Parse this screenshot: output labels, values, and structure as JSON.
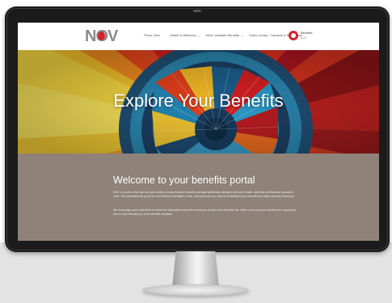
{
  "brand": {
    "logo_text": "NOV",
    "accent": "#d3232e"
  },
  "nav": {
    "items": [
      {
        "label": "Plans View"
      },
      {
        "label": "Health & Wellness ⌄"
      },
      {
        "label": "Other Valuable Benefits ⌄"
      },
      {
        "label": "Video Library"
      },
      {
        "label": "Contacts & Resources"
      }
    ],
    "region_label": "Benefits",
    "region_sub": "U.S."
  },
  "hero": {
    "title": "Explore Your Benefits"
  },
  "welcome": {
    "title": "Welcome to your benefits portal",
    "paragraph1": "NOV is proud to offer you and your family a comprehensive benefits package specifically designed with your health, wellness and financial security in mind. This dedicated site gives the rest with the information, tools, and resources you need to understand your benefits and make informed decisions.",
    "paragraph2": "We encourage you to take time to review the information and other resources to help to the benefits site. When a and why you includes the a group the icon to help educate you on its benefits available.",
    "bg_color": "#8e8279"
  }
}
